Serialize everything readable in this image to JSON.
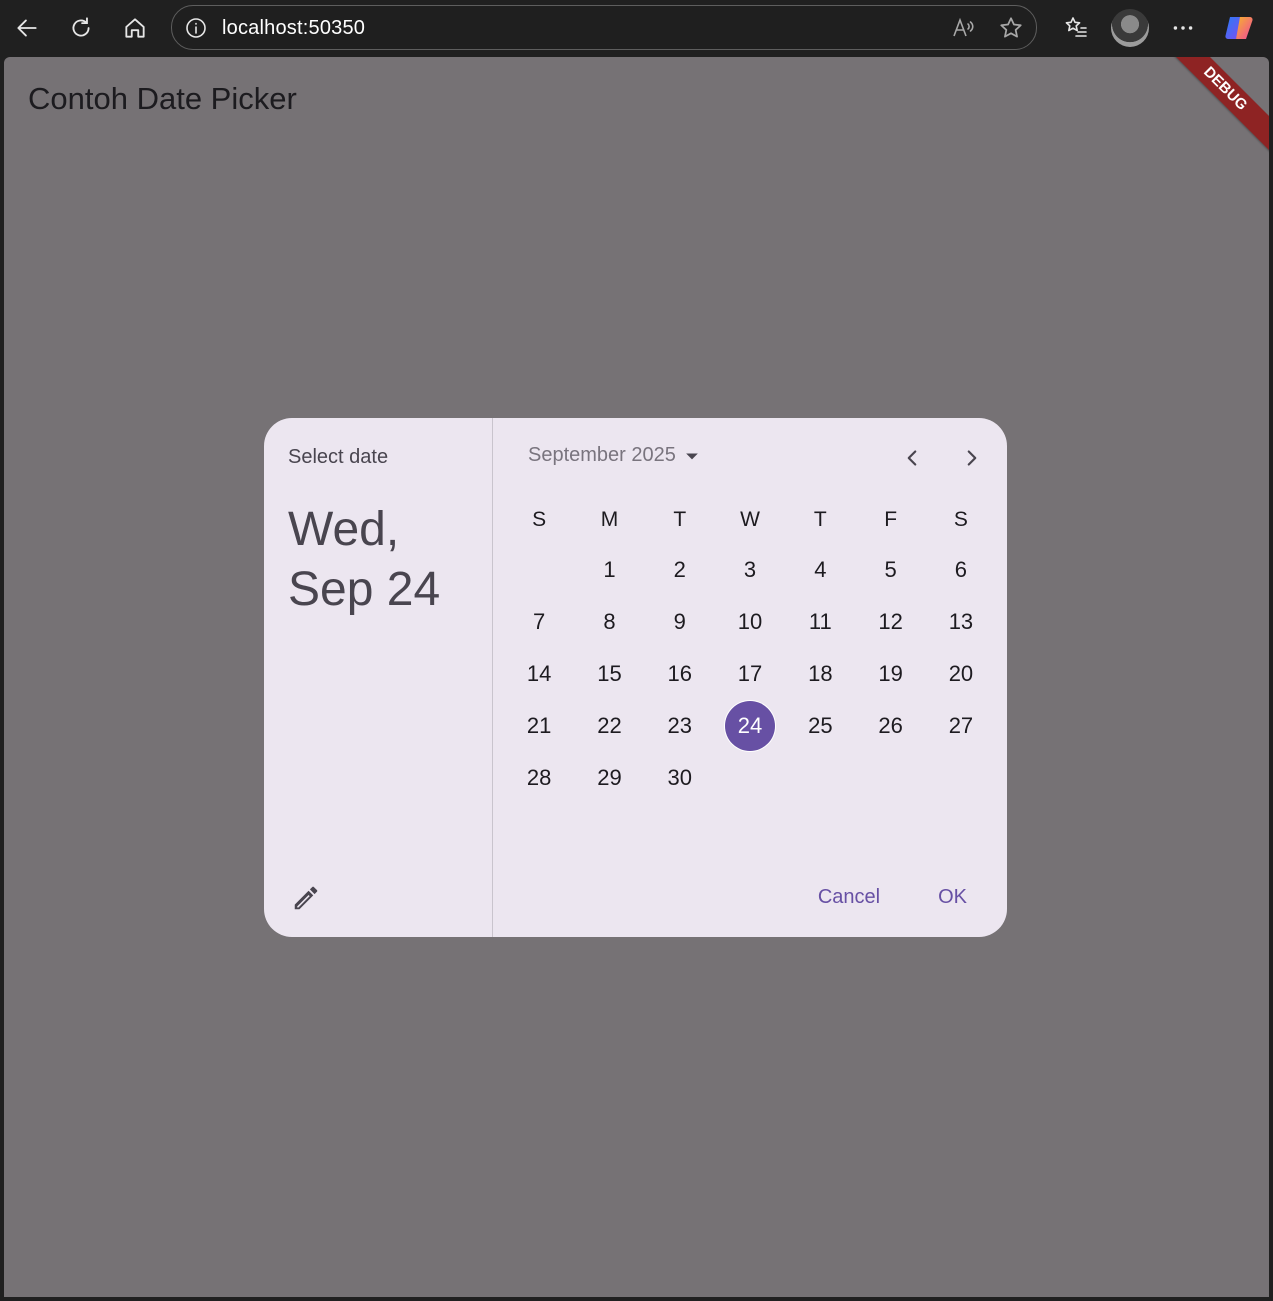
{
  "browser": {
    "url": "localhost:50350"
  },
  "app": {
    "title": "Contoh Date Picker",
    "debug_banner": "DEBUG"
  },
  "dialog": {
    "label": "Select date",
    "headline_line1": "Wed,",
    "headline_line2": "Sep 24",
    "month_year": "September 2025",
    "weekdays": [
      "S",
      "M",
      "T",
      "W",
      "T",
      "F",
      "S"
    ],
    "leading_blanks": 1,
    "days": [
      "1",
      "2",
      "3",
      "4",
      "5",
      "6",
      "7",
      "8",
      "9",
      "10",
      "11",
      "12",
      "13",
      "14",
      "15",
      "16",
      "17",
      "18",
      "19",
      "20",
      "21",
      "22",
      "23",
      "24",
      "25",
      "26",
      "27",
      "28",
      "29",
      "30"
    ],
    "selected_day": "24",
    "cancel_label": "Cancel",
    "ok_label": "OK"
  },
  "colors": {
    "accent": "#6750a4",
    "scrim": "#767275",
    "surface": "#ece6f0"
  }
}
